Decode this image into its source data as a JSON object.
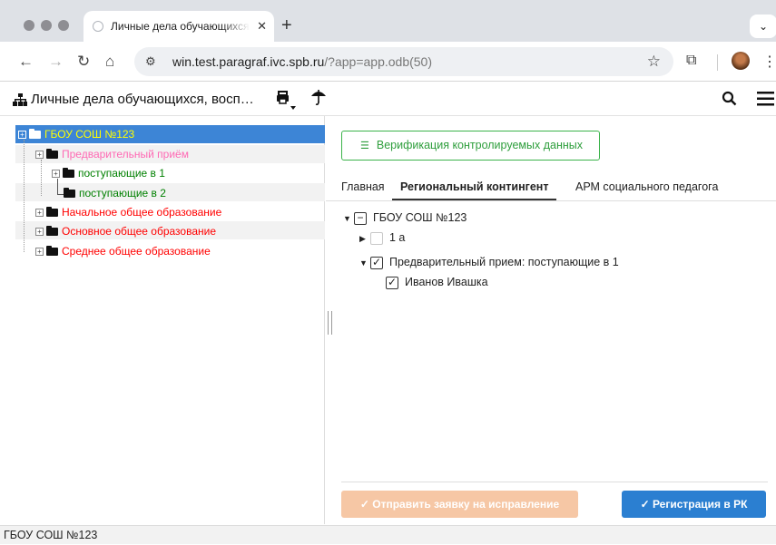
{
  "browser": {
    "tab_title": "Личные дела обучающихся, в",
    "tab_close": "✕",
    "new_tab": "+",
    "tab_menu": "⌄",
    "url_host": "win.test.paragraf.ivc.spb.ru",
    "url_path": "/?app=app.odb(50)",
    "back": "←",
    "forward": "→",
    "reload": "↻",
    "home": "⌂",
    "bookmark": "☆",
    "extensions": "⧉",
    "menu": "⋮"
  },
  "app": {
    "title": "Личные дела обучающихся, восп…",
    "print_icon": "🖶",
    "umbrella_icon": "☂",
    "search_icon": "🔍",
    "menu_icon": "☰"
  },
  "tree": {
    "items": [
      {
        "label": "ГБОУ СОШ №123",
        "color": "#ffff00",
        "selected": true
      },
      {
        "label": "Предварительный приём",
        "color": "#ff69b4"
      },
      {
        "label": "поступающие в 1",
        "color": "#008000"
      },
      {
        "label": "поступающие в 2",
        "color": "#008000"
      },
      {
        "label": "Начальное общее образование",
        "color": "#ff0000"
      },
      {
        "label": "Основное общее образование",
        "color": "#ff0000"
      },
      {
        "label": "Среднее общее образование",
        "color": "#ff0000"
      }
    ],
    "expander": "+"
  },
  "right": {
    "verify_label": "Верификация контролируемых данных",
    "verify_icon": "☰",
    "tabs": [
      "Главная",
      "Региональный контингент",
      "АРМ социального педагога"
    ],
    "contingent": {
      "root": "ГБОУ СОШ №123",
      "class": "1 а",
      "group": "Предварительный прием: поступающие в 1",
      "student": "Иванов Ивашка",
      "check": "✓",
      "minus": "−"
    },
    "btn_fix": "✓  Отправить заявку на исправление",
    "btn_register": "✓  Регистрация в РК"
  },
  "status": "ГБОУ СОШ №123",
  "colors": {
    "selected_row": "#3d85d6",
    "accent_green": "#3bb34a",
    "btn_fix": "#f6c7a5",
    "btn_register": "#2b7fd1"
  }
}
